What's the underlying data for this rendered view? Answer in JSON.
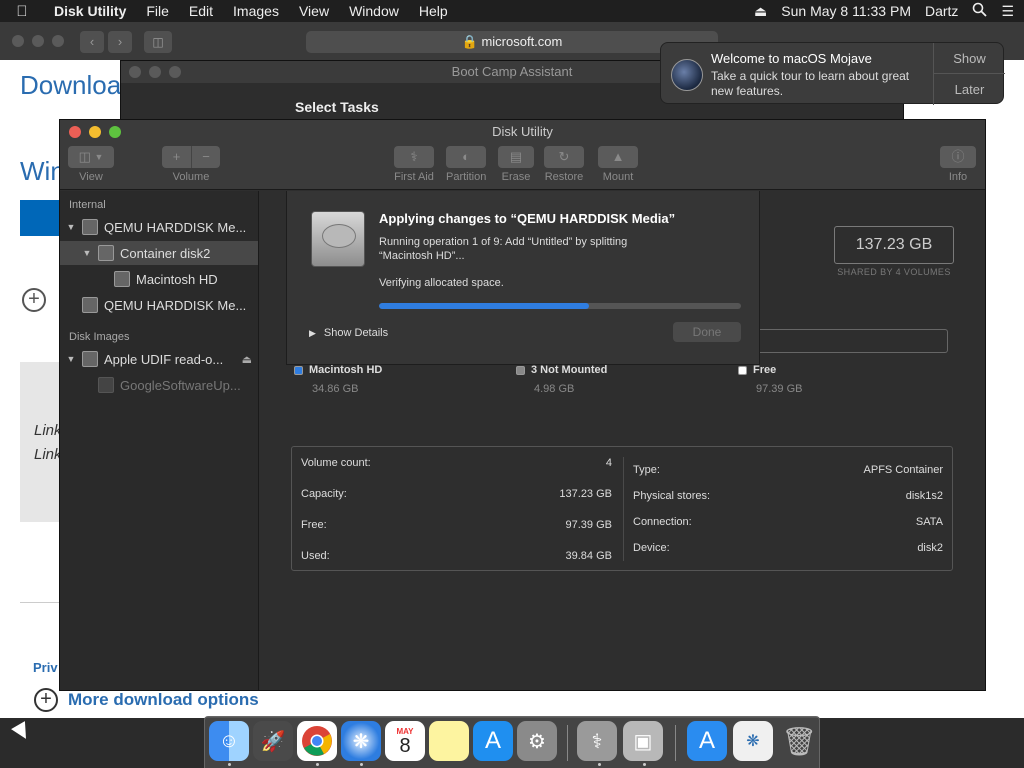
{
  "menubar": {
    "app_name": "Disk Utility",
    "items": [
      "File",
      "Edit",
      "Images",
      "View",
      "Window",
      "Help"
    ],
    "clock": "Sun May 8  11:33 PM",
    "user": "Dartz"
  },
  "safari": {
    "url": "microsoft.com",
    "heading": "Downloa",
    "subheading": "Win",
    "link1": "Link",
    "link2": "Link",
    "privacy": "Priv",
    "more_options": "More download options"
  },
  "bootcamp": {
    "title": "Boot Camp Assistant",
    "heading": "Select Tasks"
  },
  "notification": {
    "title": "Welcome to macOS Mojave",
    "body": "Take a quick tour to learn about great new features.",
    "show": "Show",
    "later": "Later"
  },
  "disk_utility": {
    "title": "Disk Utility",
    "toolbar": {
      "view": "View",
      "volume": "Volume",
      "first_aid": "First Aid",
      "partition": "Partition",
      "erase": "Erase",
      "restore": "Restore",
      "mount": "Mount",
      "info": "Info"
    },
    "sidebar": {
      "internal_header": "Internal",
      "disk_images_header": "Disk Images",
      "items": [
        {
          "label": "QEMU HARDDISK Me..."
        },
        {
          "label": "Container disk2"
        },
        {
          "label": "Macintosh HD"
        },
        {
          "label": "QEMU HARDDISK Me..."
        },
        {
          "label": "Apple UDIF read-o..."
        },
        {
          "label": "GoogleSoftwareUp..."
        }
      ]
    },
    "sheet": {
      "title": "Applying changes to “QEMU HARDDISK Media”",
      "operation": "Running operation 1 of 9: Add “Untitled” by splitting “Macintosh HD”...",
      "status": "Verifying allocated space.",
      "progress": 0.58,
      "show_details": "Show Details",
      "done": "Done"
    },
    "capacity": "137.23 GB",
    "capacity_sub": "SHARED BY 4 VOLUMES",
    "legend": [
      {
        "name": "Macintosh HD",
        "size": "34.86 GB",
        "color": "#2f7de0"
      },
      {
        "name": "3 Not Mounted",
        "size": "4.98 GB",
        "color": "#888888"
      },
      {
        "name": "Free",
        "size": "97.39 GB",
        "color": "#ffffff"
      }
    ],
    "info_left": [
      {
        "label": "Volume count:",
        "value": "4"
      },
      {
        "label": "Capacity:",
        "value": "137.23 GB"
      },
      {
        "label": "Free:",
        "value": "97.39 GB"
      },
      {
        "label": "Used:",
        "value": "39.84 GB"
      }
    ],
    "info_right": [
      {
        "label": "Type:",
        "value": "APFS Container"
      },
      {
        "label": "Physical stores:",
        "value": "disk1s2"
      },
      {
        "label": "Connection:",
        "value": "SATA"
      },
      {
        "label": "Device:",
        "value": "disk2"
      }
    ]
  },
  "dock": {
    "calendar_month": "MAY",
    "calendar_day": "8"
  }
}
